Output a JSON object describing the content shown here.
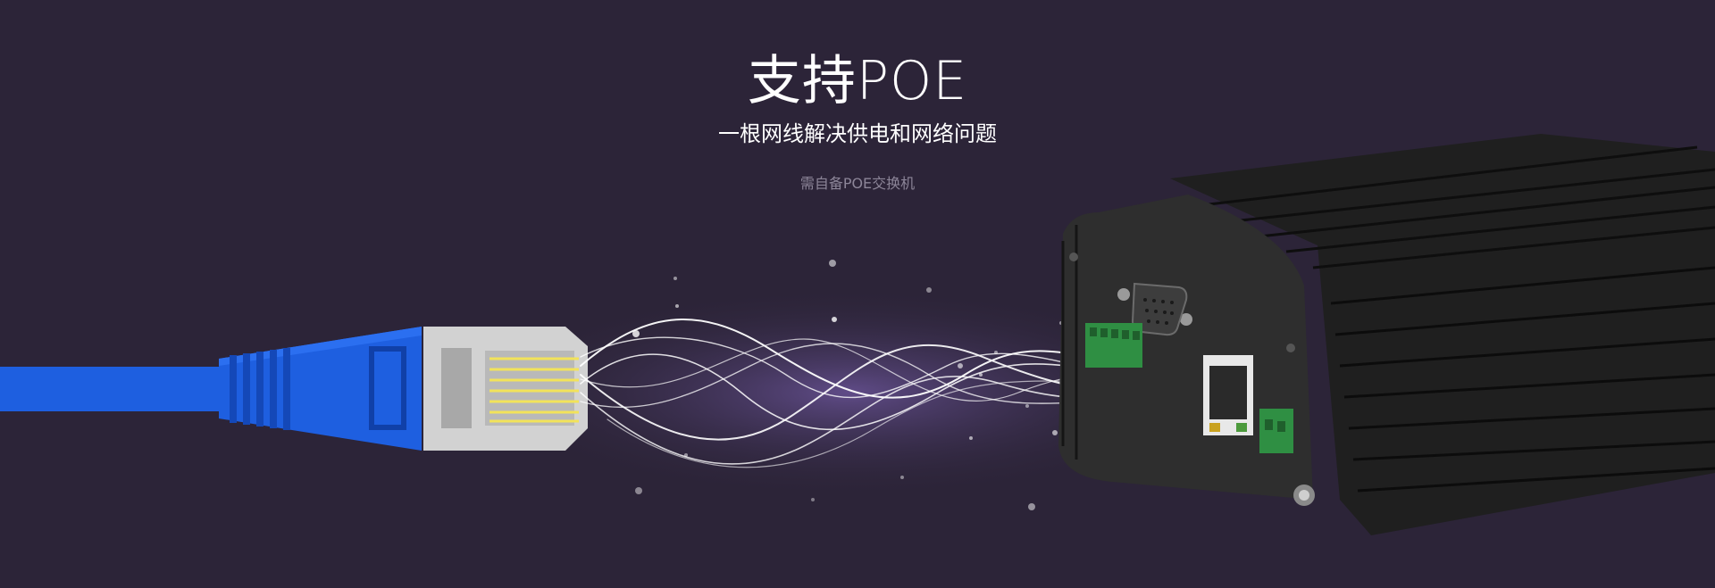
{
  "banner": {
    "title": "支持POE",
    "subtitle": "一根网线解决供电和网络问题",
    "note": "需自备POE交换机"
  },
  "colors": {
    "background": "#2c2438",
    "cable": "#1e5fe0",
    "plug": "#d2d2d2",
    "contacts": "#f2e35a",
    "device": "#262626",
    "terminal": "#2f8f43"
  },
  "icons": [
    "ethernet-cable-icon",
    "rj45-plug-icon",
    "network-device-icon",
    "vga-port-icon",
    "ethernet-port-icon",
    "terminal-block-icon"
  ]
}
